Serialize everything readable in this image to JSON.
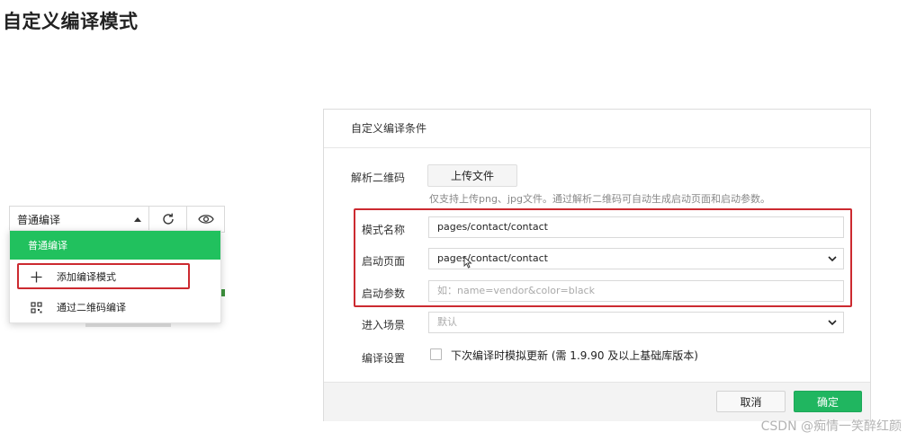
{
  "page_title": "自定义编译模式",
  "toolbar": {
    "compile_mode": "普通编译",
    "refresh_icon": "refresh-icon",
    "preview_icon": "eye-icon"
  },
  "dropdown": {
    "items": [
      {
        "label": "普通编译",
        "selected": true
      },
      {
        "label": "添加编译模式",
        "icon": "plus-icon"
      },
      {
        "label": "通过二维码编译",
        "icon": "qrcode-icon"
      }
    ]
  },
  "dialog": {
    "title": "自定义编译条件",
    "qr_label": "解析二维码",
    "upload_label": "上传文件",
    "upload_hint": "仅支持上传png、jpg文件。通过解析二维码可自动生成启动页面和启动参数。",
    "mode_name_label": "模式名称",
    "mode_name_value": "pages/contact/contact",
    "start_page_label": "启动页面",
    "start_page_value": "pages/contact/contact",
    "start_params_label": "启动参数",
    "start_params_placeholder": "如：name=vendor&color=black",
    "scene_label": "进入场景",
    "scene_value": "默认",
    "compile_settings_label": "编译设置",
    "simulate_update_label": "下次编译时模拟更新 (需 1.9.90 及以上基础库版本)",
    "simulate_update_checked": false,
    "cancel_label": "取消",
    "ok_label": "确定"
  },
  "watermark": "CSDN @痴情一笑醉红颜",
  "colors": {
    "accent_green": "#21c15e",
    "highlight_red": "#cc2a30"
  }
}
